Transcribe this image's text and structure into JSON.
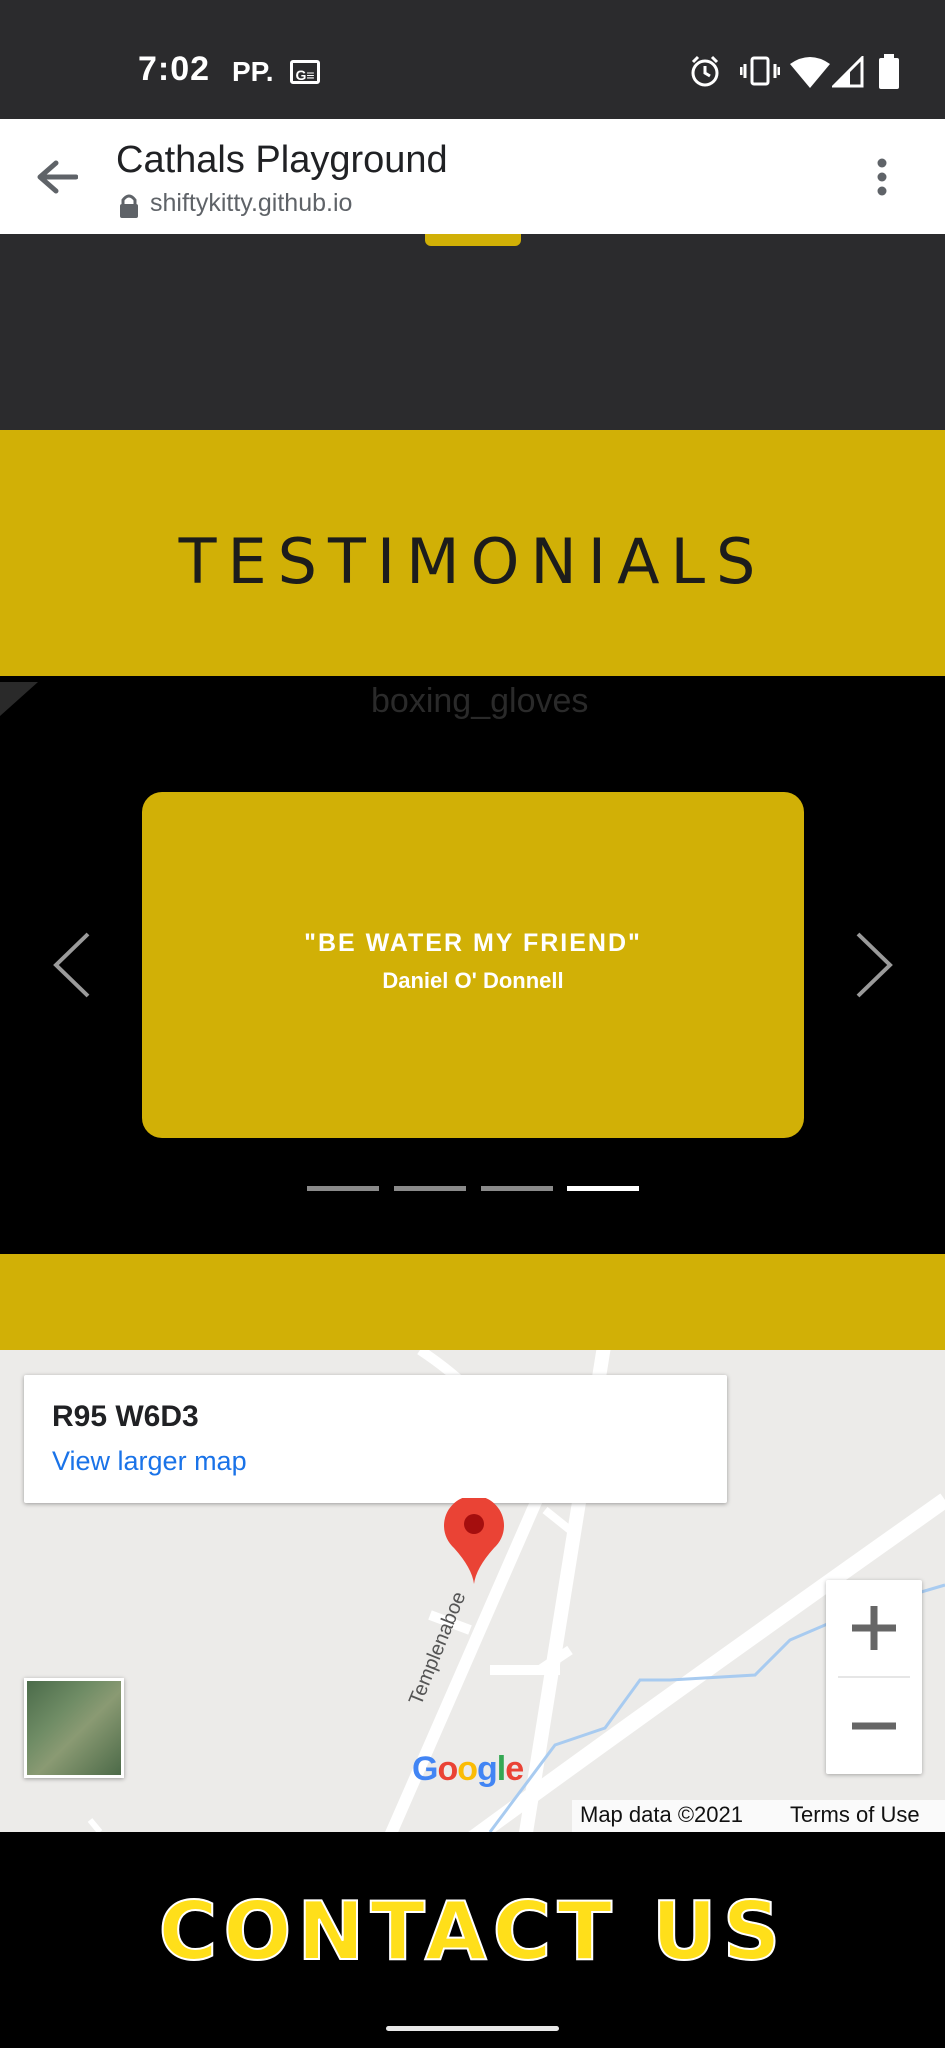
{
  "status_bar": {
    "time": "7:02",
    "ampm": "PP.",
    "badge": "G≡"
  },
  "tab": {
    "title": "Cathals Playground",
    "url": "shiftykitty.github.io"
  },
  "testimonials": {
    "heading": "TESTIMONIALS",
    "image_alt": "boxing_gloves",
    "slide": {
      "quote": "\"BE WATER MY FRIEND\"",
      "author": "Daniel O' Donnell"
    },
    "indicator_count": 4,
    "active_indicator": 4
  },
  "map": {
    "place_code": "R95 W6D3",
    "larger_map_link": "View larger map",
    "street_name": "Templenaboe",
    "logo_text": "Google",
    "attribution": "Map data ©2021",
    "terms": "Terms of Use"
  },
  "contact": {
    "heading": "CONTACT US"
  },
  "colors": {
    "accent": "#d1b006",
    "dark": "#2b2b2d",
    "contact_text": "#ffdf1a"
  }
}
